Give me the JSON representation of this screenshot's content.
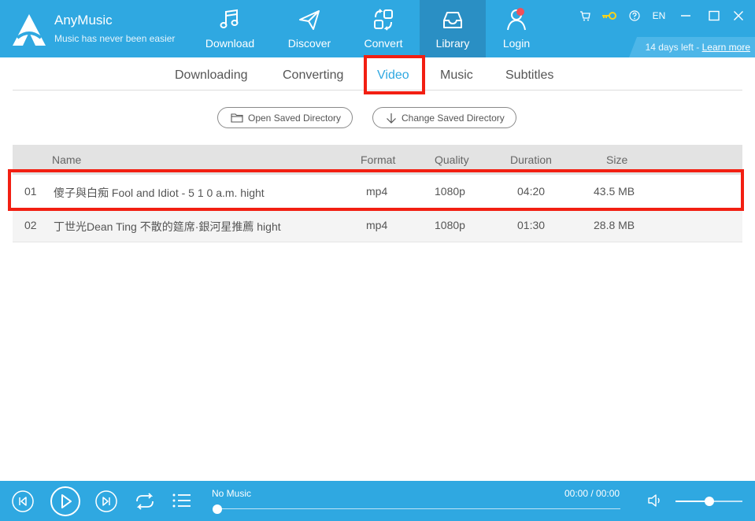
{
  "app": {
    "name": "AnyMusic",
    "tagline": "Music has never been easier"
  },
  "nav": {
    "download": "Download",
    "discover": "Discover",
    "convert": "Convert",
    "library": "Library",
    "login": "Login"
  },
  "window_controls": {
    "language": "EN"
  },
  "trial": {
    "days_left": "14 days left - ",
    "link": "Learn more"
  },
  "subtabs": {
    "downloading": "Downloading",
    "converting": "Converting",
    "video": "Video",
    "music": "Music",
    "subtitles": "Subtitles",
    "active": "Video"
  },
  "buttons": {
    "open_dir": "Open Saved Directory",
    "change_dir": "Change Saved Directory"
  },
  "table": {
    "headers": {
      "name": "Name",
      "format": "Format",
      "quality": "Quality",
      "duration": "Duration",
      "size": "Size"
    },
    "rows": [
      {
        "index": "01",
        "title": "傻子與白痴 Fool and Idiot - 5 1 0 a.m. hight",
        "format": "mp4",
        "quality": "1080p",
        "duration": "04:20",
        "size": "43.5 MB"
      },
      {
        "index": "02",
        "title": "丁世光Dean Ting 不散的筵席·銀河星推薦 hight",
        "format": "mp4",
        "quality": "1080p",
        "duration": "01:30",
        "size": "28.8 MB"
      }
    ]
  },
  "player": {
    "now_playing": "No Music",
    "time": "00:00 / 00:00",
    "progress": 0,
    "volume": 0.5
  },
  "colors": {
    "brand": "#2fa8e1",
    "active_nav": "#2a8fc4",
    "highlight": "#f21f12",
    "notification_dot": "#f0505a"
  }
}
